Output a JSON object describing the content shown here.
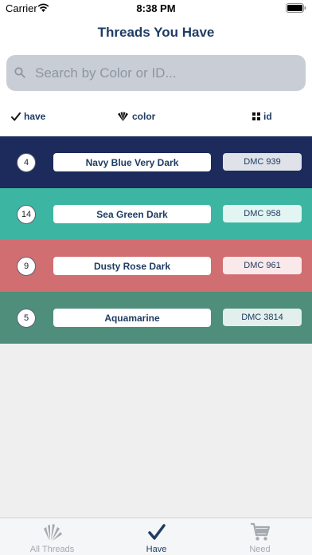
{
  "status_bar": {
    "carrier": "Carrier",
    "time": "8:38 PM"
  },
  "header": {
    "title": "Threads You Have"
  },
  "search": {
    "placeholder": "Search by Color or ID..."
  },
  "columns": {
    "have": "have",
    "color": "color",
    "id": "id"
  },
  "threads": [
    {
      "quantity": "4",
      "name": "Navy Blue Very Dark",
      "id": "DMC 939",
      "row_color": "#1c2a5c",
      "id_color": "#dfe2e8"
    },
    {
      "quantity": "14",
      "name": "Sea Green Dark",
      "id": "DMC 958",
      "row_color": "#3cb6a2",
      "id_color": "#e2f5f2"
    },
    {
      "quantity": "9",
      "name": "Dusty Rose Dark",
      "id": "DMC 961",
      "row_color": "#d06e71",
      "id_color": "#fae9ea"
    },
    {
      "quantity": "5",
      "name": "Aquamarine",
      "id": "DMC 3814",
      "row_color": "#4f8e7b",
      "id_color": "#e3efec"
    }
  ],
  "tabs": [
    {
      "label": "All Threads",
      "icon": "spools-icon",
      "active": false
    },
    {
      "label": "Have",
      "icon": "checkmark-icon",
      "active": true
    },
    {
      "label": "Need",
      "icon": "cart-icon",
      "active": false
    }
  ],
  "colors": {
    "accent": "#1f3c63",
    "tab_inactive": "#a5a9b1",
    "search_bg": "#c9ced6"
  }
}
